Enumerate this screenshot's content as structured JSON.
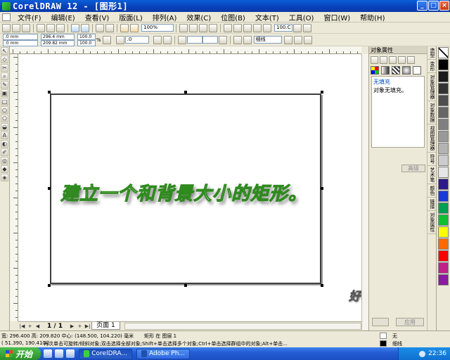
{
  "window": {
    "title": "CorelDRAW 12 - [图形1]",
    "minimize": "_",
    "maximize": "□",
    "close": "×"
  },
  "menu": [
    "文件(F)",
    "编辑(E)",
    "查看(V)",
    "版面(L)",
    "排列(A)",
    "效果(C)",
    "位图(B)",
    "文本(T)",
    "工具(O)",
    "窗口(W)",
    "帮助(H)"
  ],
  "toolbar": {
    "zoom": "100%",
    "snap_value": "100.C"
  },
  "properties": {
    "x": ".0 mm",
    "y": ".0 mm",
    "width": "296.4 mm",
    "height": "209.82 mm",
    "scale_x": "100.0",
    "scale_y": "100.0",
    "percent": "%",
    "rotation": ".0",
    "outline": "细线"
  },
  "canvas": {
    "caption": "建立一个和背景大小的矩形。",
    "signature": "好心情"
  },
  "page_nav": {
    "page_count": "1 / 1",
    "page_tab": "页面 1"
  },
  "docker": {
    "title": "对象属性",
    "fill_label": "无填充",
    "fill_desc": "对象无填充。",
    "advanced": "高级",
    "apply": "应用"
  },
  "docker_tabs": [
    "造型",
    "变形",
    "对象管理器",
    "对象数据",
    "视图管理器",
    "符号",
    "艺术笔",
    "颜色",
    "链接",
    "对象属性"
  ],
  "palette": [
    "#ffffff",
    "#000000",
    "#1a1a1a",
    "#333333",
    "#4d4d4d",
    "#666666",
    "#808080",
    "#999999",
    "#b3b3b3",
    "#cccccc",
    "#e6e6e6",
    "#2e1a8a",
    "#1a3ad8",
    "#00a050",
    "#10c030",
    "#ffff00",
    "#ff6a00",
    "#ff0000",
    "#c0208a",
    "#8a1aa0"
  ],
  "status": {
    "size": "宽: 296.400  高: 209.820  中心: (148.500, 104.220)  毫米",
    "object": "矩形 在 图层 1",
    "coords": "( 51.390, 190.410 )",
    "hint": "再次单击可旋转/倾斜对象;双击选择全部对象;Shift+单击选择多个对象;Ctrl+单击选择群组中的对象;Alt+单击...",
    "fill_state": "无",
    "outline_state": "细线"
  },
  "taskbar": {
    "start": "开始",
    "tasks": [
      "CorelDRA...",
      "Adobe Ph..."
    ],
    "time": "22:36"
  }
}
